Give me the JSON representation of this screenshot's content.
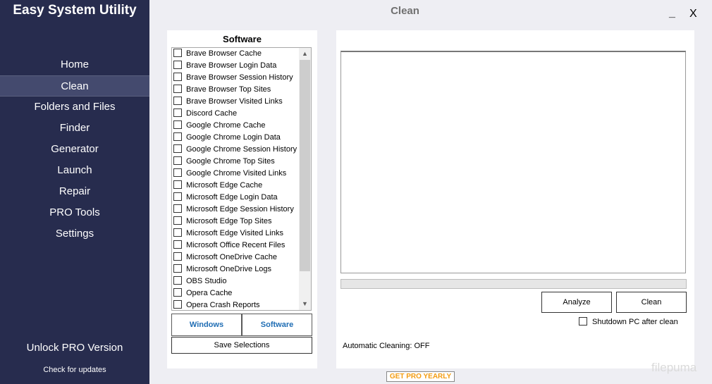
{
  "app": {
    "title": "Easy System Utility",
    "page_title": "Clean",
    "minimize": "_",
    "close": "X"
  },
  "sidebar": {
    "items": [
      {
        "label": "Home",
        "active": false
      },
      {
        "label": "Clean",
        "active": true
      },
      {
        "label": "Folders and Files",
        "active": false
      },
      {
        "label": "Finder",
        "active": false
      },
      {
        "label": "Generator",
        "active": false
      },
      {
        "label": "Launch",
        "active": false
      },
      {
        "label": "Repair",
        "active": false
      },
      {
        "label": "PRO Tools",
        "active": false
      },
      {
        "label": "Settings",
        "active": false
      }
    ],
    "unlock": "Unlock PRO Version",
    "updates": "Check for updates"
  },
  "software": {
    "title": "Software",
    "items": [
      {
        "label": "Brave Browser Cache",
        "checked": false
      },
      {
        "label": "Brave Browser Login Data",
        "checked": false
      },
      {
        "label": "Brave Browser Session History",
        "checked": false
      },
      {
        "label": "Brave Browser Top Sites",
        "checked": false
      },
      {
        "label": "Brave Browser Visited Links",
        "checked": false
      },
      {
        "label": "Discord Cache",
        "checked": false
      },
      {
        "label": "Google Chrome Cache",
        "checked": false
      },
      {
        "label": "Google Chrome Login Data",
        "checked": false
      },
      {
        "label": "Google Chrome Session History",
        "checked": false
      },
      {
        "label": "Google Chrome Top Sites",
        "checked": false
      },
      {
        "label": "Google Chrome Visited Links",
        "checked": false
      },
      {
        "label": "Microsoft Edge Cache",
        "checked": false
      },
      {
        "label": "Microsoft Edge Login Data",
        "checked": false
      },
      {
        "label": "Microsoft Edge Session History",
        "checked": false
      },
      {
        "label": "Microsoft Edge Top Sites",
        "checked": false
      },
      {
        "label": "Microsoft Edge Visited Links",
        "checked": false
      },
      {
        "label": "Microsoft Office Recent Files",
        "checked": false
      },
      {
        "label": "Microsoft OneDrive Cache",
        "checked": false
      },
      {
        "label": "Microsoft OneDrive Logs",
        "checked": false
      },
      {
        "label": "OBS Studio",
        "checked": false
      },
      {
        "label": "Opera Cache",
        "checked": false
      },
      {
        "label": "Opera Crash Reports",
        "checked": false
      }
    ],
    "tab_windows": "Windows",
    "tab_software": "Software",
    "save_label": "Save Selections"
  },
  "main": {
    "progress": 0,
    "analyze_label": "Analyze",
    "clean_label": "Clean",
    "shutdown_label": "Shutdown PC after clean",
    "shutdown_checked": false,
    "auto_cleaning": "Automatic Cleaning: OFF"
  },
  "promo": "GET PRO YEARLY",
  "watermark": "filepuma",
  "colors": {
    "sidebar_bg": "#272c4e",
    "active_item_bg": "#444a6e",
    "tab_text": "#1f6db4",
    "promo_text": "#f39c12"
  }
}
